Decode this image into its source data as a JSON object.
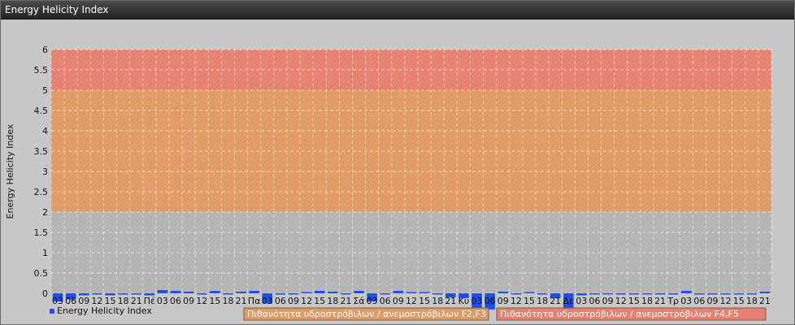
{
  "window": {
    "title": "Energy Helicity Index"
  },
  "colors": {
    "bar": "#1f4ff0",
    "band_low": "#b4b4b4",
    "band_mid": "#e09a64",
    "band_high": "#e68070",
    "background": "#c8c8c8",
    "title_bar": "#2e2e2e"
  },
  "chart_data": {
    "type": "bar",
    "ylabel": "Energy Helicity Index",
    "ylim": [
      0,
      6
    ],
    "yticks": [
      "0",
      "0.5",
      "1",
      "1.5",
      "2",
      "2.5",
      "3",
      "3.5",
      "4",
      "4.5",
      "5",
      "5.5",
      "6"
    ],
    "grid": true,
    "legend": {
      "position": "bottom-left",
      "entries": [
        "Energy Helicity Index"
      ]
    },
    "bands": [
      {
        "from": 0,
        "to": 2,
        "color": "#b4b4b4",
        "label": ""
      },
      {
        "from": 2,
        "to": 5,
        "color": "#e09a64",
        "label": "Πιθανότητα υδροστρόβιλων / ανεμοστρόβιλων F2,F3"
      },
      {
        "from": 5,
        "to": 6,
        "color": "#e68070",
        "label": "Πιθανότητα υδροστρόβιλων / ανεμοστρόβιλων F4,F5"
      }
    ],
    "categories": [
      "03",
      "06",
      "09",
      "12",
      "15",
      "18",
      "21",
      "Πέ",
      "03",
      "06",
      "09",
      "12",
      "15",
      "18",
      "21",
      "Πα",
      "03",
      "06",
      "09",
      "12",
      "15",
      "18",
      "21",
      "Σά",
      "03",
      "06",
      "09",
      "12",
      "15",
      "18",
      "21",
      "Κυ",
      "03",
      "06",
      "09",
      "12",
      "15",
      "18",
      "21",
      "Δε",
      "03",
      "06",
      "09",
      "12",
      "15",
      "18",
      "21",
      "Τρ",
      "03",
      "06",
      "09",
      "12",
      "15",
      "18",
      "21"
    ],
    "values": [
      -0.2,
      -0.15,
      -0.05,
      0,
      -0.05,
      0,
      0,
      -0.05,
      0.08,
      0.06,
      0.04,
      0,
      0.06,
      0,
      0.04,
      0.06,
      -0.25,
      0,
      0,
      0.03,
      0.06,
      0.04,
      0,
      0.06,
      -0.2,
      0,
      0.06,
      0.03,
      0.03,
      0,
      -0.1,
      -0.12,
      -0.5,
      -0.4,
      0.04,
      0,
      0.03,
      0,
      -0.12,
      -0.4,
      -0.05,
      0,
      0,
      0,
      0,
      0,
      0,
      0,
      0.06,
      0,
      0,
      0,
      0,
      0,
      0.04
    ]
  }
}
